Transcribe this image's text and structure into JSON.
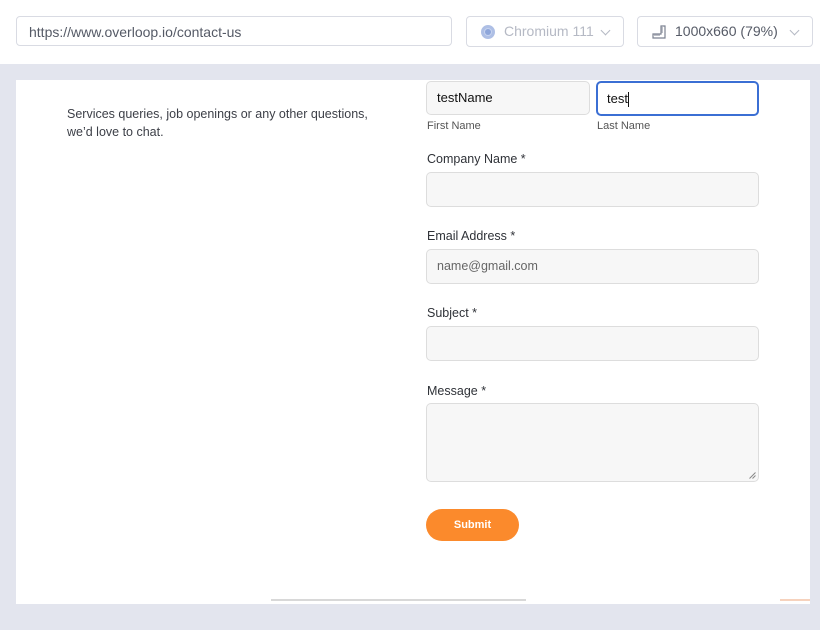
{
  "toolbar": {
    "url": "https://www.overloop.io/contact-us",
    "browser": "Chromium 111",
    "viewport": "1000x660",
    "zoom": "(79%)"
  },
  "page": {
    "intro_text": "Services queries, job openings or any other questions, we’d love to chat.",
    "form": {
      "first_name_value": "testName",
      "first_name_label": "First Name",
      "last_name_value": "test",
      "last_name_label": "Last Name",
      "company_label": "Company Name *",
      "company_value": "",
      "email_label": "Email Address *",
      "email_placeholder": "name@gmail.com",
      "subject_label": "Subject *",
      "subject_value": "",
      "message_label": "Message *",
      "message_value": "",
      "submit_label": "Submit"
    }
  },
  "colors": {
    "submit": "#fb8a2c",
    "focus_border": "#3b6fd4",
    "backdrop": "#e3e5ee"
  }
}
